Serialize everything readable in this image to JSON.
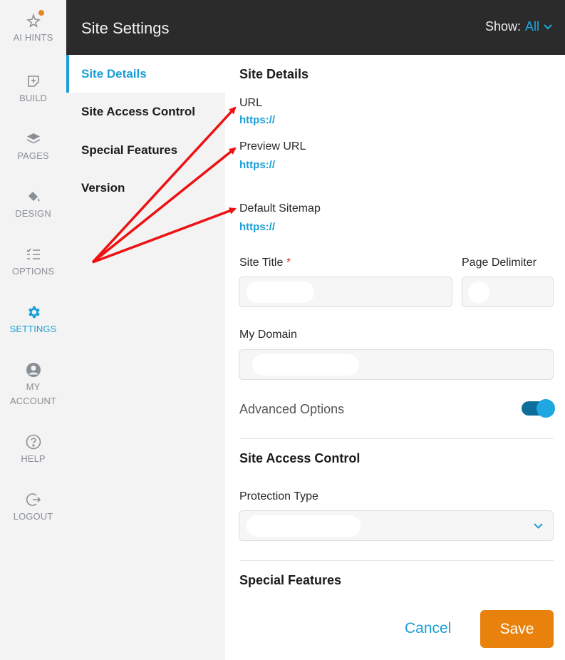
{
  "rail": {
    "items": [
      {
        "label": "AI HINTS",
        "icon": "sparkle-star-icon"
      },
      {
        "label": "BUILD",
        "icon": "add-page-icon"
      },
      {
        "label": "PAGES",
        "icon": "layers-icon"
      },
      {
        "label": "DESIGN",
        "icon": "paint-bucket-icon"
      },
      {
        "label": "OPTIONS",
        "icon": "checklist-icon"
      },
      {
        "label": "SETTINGS",
        "icon": "gear-icon"
      },
      {
        "label": "MY ACCOUNT",
        "icon": "user-circle-icon"
      },
      {
        "label": "HELP",
        "icon": "help-circle-icon"
      },
      {
        "label": "LOGOUT",
        "icon": "logout-icon"
      }
    ],
    "active": "SETTINGS",
    "notification_color": "#e38a1f"
  },
  "header": {
    "title": "Site Settings",
    "show_label": "Show:",
    "show_value": "All"
  },
  "nav": {
    "items": [
      {
        "label": "Site Details",
        "active": true
      },
      {
        "label": "Site Access Control",
        "active": false
      },
      {
        "label": "Special Features",
        "active": false
      },
      {
        "label": "Version",
        "active": false
      }
    ]
  },
  "site_details": {
    "title": "Site Details",
    "url_label": "URL",
    "url_value": "https://",
    "preview_url_label": "Preview URL",
    "preview_url_value": "https://",
    "sitemap_label": "Default Sitemap",
    "sitemap_value": "https://",
    "site_title_label": "Site Title",
    "required_mark": "*",
    "page_delimiter_label": "Page Delimiter",
    "my_domain_label": "My Domain",
    "advanced_options_label": "Advanced Options",
    "advanced_options_enabled": true
  },
  "site_access_control": {
    "title": "Site Access Control",
    "protection_type_label": "Protection Type"
  },
  "special_features": {
    "title": "Special Features"
  },
  "actions": {
    "cancel_label": "Cancel",
    "save_label": "Save"
  },
  "colors": {
    "accent": "#1a9fd6",
    "header_bg": "#2b2b2b",
    "save_bg": "#e8820c",
    "annotation_arrow": "#ee1111"
  }
}
